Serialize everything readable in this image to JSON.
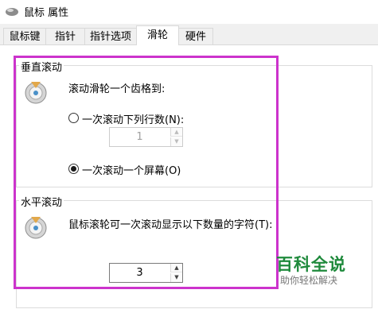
{
  "window": {
    "title": "鼠标 属性",
    "icon": "mouse-icon"
  },
  "tabs": [
    {
      "label": "鼠标键",
      "active": false
    },
    {
      "label": "指针",
      "active": false
    },
    {
      "label": "指针选项",
      "active": false
    },
    {
      "label": "滑轮",
      "active": true
    },
    {
      "label": "硬件",
      "active": false
    }
  ],
  "vertical": {
    "group_label": "垂直滚动",
    "description": "滚动滑轮一个齿格到:",
    "icon": "mouse-wheel-icon",
    "option_lines": {
      "label": "一次滚动下列行数(N):",
      "selected": false
    },
    "lines_value": "1",
    "lines_enabled": false,
    "option_screen": {
      "label": "一次滚动一个屏幕(O)",
      "selected": true
    }
  },
  "horizontal": {
    "group_label": "水平滚动",
    "description": "鼠标滚轮可一次滚动显示以下数量的字符(T):",
    "icon": "mouse-wheel-icon",
    "chars_value": "3"
  },
  "annotation": {
    "highlight_color": "#cc33cc"
  },
  "watermark": {
    "title": "百科全说",
    "subtitle": "助你轻松解决",
    "color": "#1f8a3c"
  }
}
